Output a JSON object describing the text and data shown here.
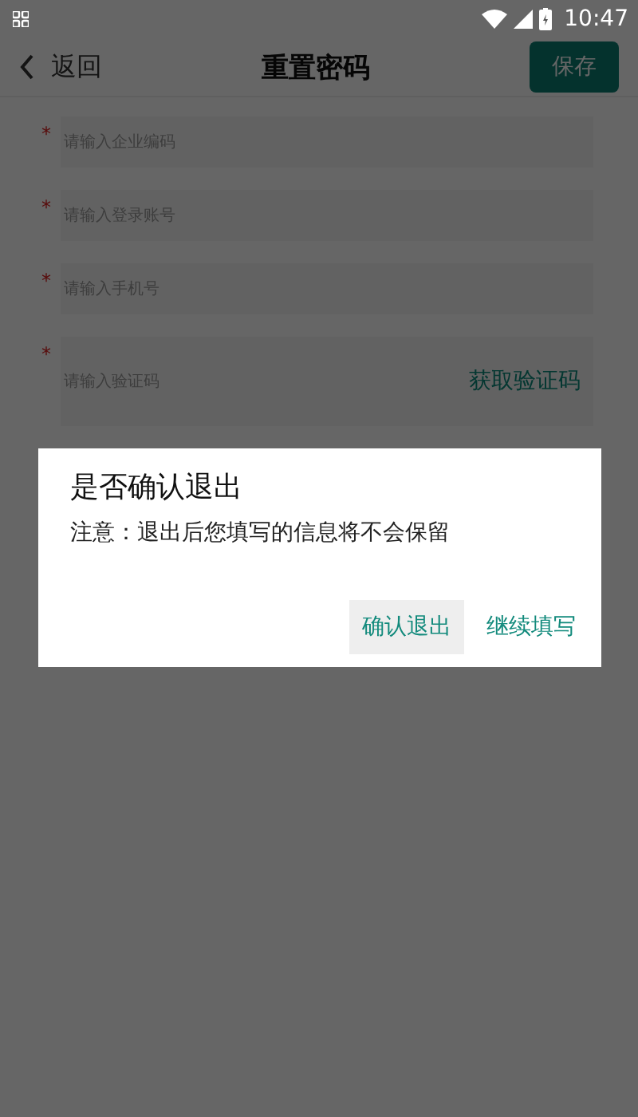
{
  "status_bar": {
    "time": "10:47"
  },
  "top_bar": {
    "back_label": "返回",
    "title": "重置密码",
    "save_label": "保存"
  },
  "fields": [
    {
      "placeholder": "请输入企业编码",
      "required": true,
      "required_mark": "*"
    },
    {
      "placeholder": "请输入登录账号",
      "required": true,
      "required_mark": "*"
    },
    {
      "placeholder": "请输入手机号",
      "required": true,
      "required_mark": "*"
    },
    {
      "placeholder": "请输入验证码",
      "required": true,
      "required_mark": "*",
      "action": "获取验证码"
    }
  ],
  "dialog": {
    "title": "是否确认退出",
    "message": "注意：退出后您填写的信息将不会保留",
    "buttons": [
      {
        "label": "确认退出",
        "focused": true
      },
      {
        "label": "继续填写",
        "focused": false
      }
    ]
  }
}
